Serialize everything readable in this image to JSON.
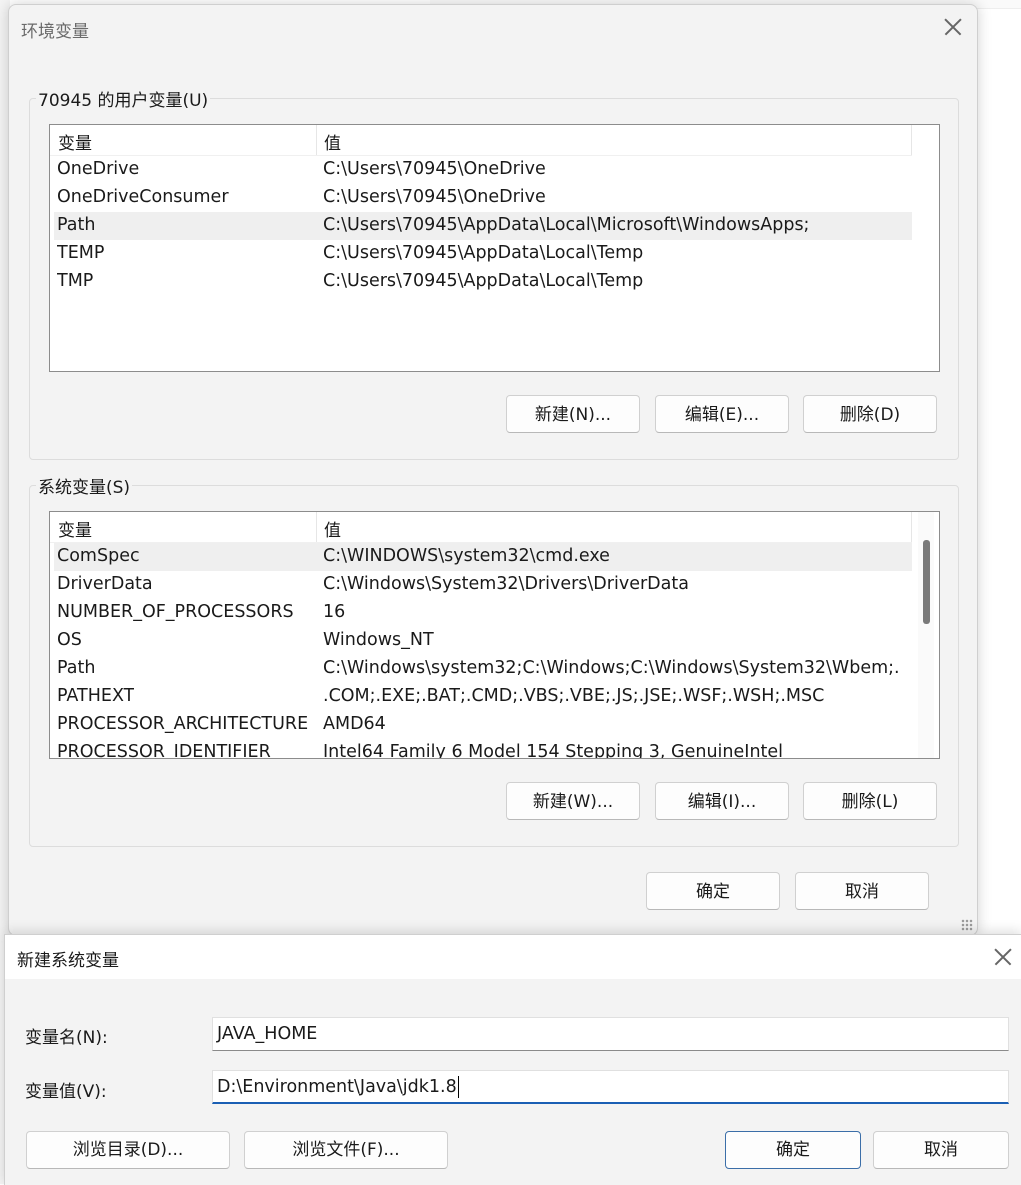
{
  "env_dialog": {
    "title": "环境变量",
    "user_group_label": "70945 的用户变量(U)",
    "system_group_label": "系统变量(S)",
    "columns": [
      "变量",
      "值"
    ],
    "user_vars": [
      {
        "name": "OneDrive",
        "value": "C:\\Users\\70945\\OneDrive"
      },
      {
        "name": "OneDriveConsumer",
        "value": "C:\\Users\\70945\\OneDrive"
      },
      {
        "name": "Path",
        "value": "C:\\Users\\70945\\AppData\\Local\\Microsoft\\WindowsApps;"
      },
      {
        "name": "TEMP",
        "value": "C:\\Users\\70945\\AppData\\Local\\Temp"
      },
      {
        "name": "TMP",
        "value": "C:\\Users\\70945\\AppData\\Local\\Temp"
      }
    ],
    "system_vars": [
      {
        "name": "ComSpec",
        "value": "C:\\WINDOWS\\system32\\cmd.exe"
      },
      {
        "name": "DriverData",
        "value": "C:\\Windows\\System32\\Drivers\\DriverData"
      },
      {
        "name": "NUMBER_OF_PROCESSORS",
        "value": "16"
      },
      {
        "name": "OS",
        "value": "Windows_NT"
      },
      {
        "name": "Path",
        "value": "C:\\Windows\\system32;C:\\Windows;C:\\Windows\\System32\\Wbem;..."
      },
      {
        "name": "PATHEXT",
        "value": ".COM;.EXE;.BAT;.CMD;.VBS;.VBE;.JS;.JSE;.WSF;.WSH;.MSC"
      },
      {
        "name": "PROCESSOR_ARCHITECTURE",
        "value": "AMD64"
      },
      {
        "name": "PROCESSOR_IDENTIFIER",
        "value": "Intel64 Family 6 Model 154 Stepping 3, GenuineIntel"
      }
    ],
    "user_buttons": {
      "new": "新建(N)...",
      "edit": "编辑(E)...",
      "delete": "删除(D)"
    },
    "system_buttons": {
      "new": "新建(W)...",
      "edit": "编辑(I)...",
      "delete": "删除(L)"
    },
    "ok": "确定",
    "cancel": "取消"
  },
  "new_var_dialog": {
    "title": "新建系统变量",
    "name_label": "变量名(N):",
    "name_value": "JAVA_HOME",
    "value_label": "变量值(V):",
    "value_value": "D:\\Environment\\Java\\jdk1.8",
    "browse_dir": "浏览目录(D)...",
    "browse_file": "浏览文件(F)...",
    "ok": "确定",
    "cancel": "取消"
  },
  "colors": {
    "dialog_bg": "#f3f3f3",
    "focus_accent": "#1a5fb4",
    "selection": "#efefef"
  }
}
